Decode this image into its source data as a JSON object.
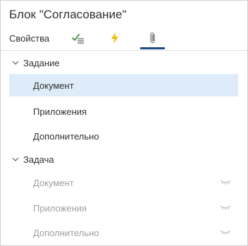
{
  "block": {
    "title": "Блок \"Согласование\""
  },
  "tabs": [
    {
      "label": "Свойства",
      "icon": ""
    },
    {
      "label": "",
      "icon": "checklist-icon"
    },
    {
      "label": "",
      "icon": "lightning-icon"
    },
    {
      "label": "",
      "icon": "paperclip-icon"
    }
  ],
  "colors": {
    "accent": "#1e4a86",
    "selected_bg": "#deecf9",
    "checklist_green": "#2e8b2e",
    "lightning_yellow": "#f2b705"
  },
  "groups": [
    {
      "label": "Задание",
      "items": [
        {
          "label": "Документ",
          "state": "selected"
        },
        {
          "label": "Приложения",
          "state": "enabled"
        },
        {
          "label": "Дополнительно",
          "state": "enabled"
        }
      ]
    },
    {
      "label": "Задача",
      "items": [
        {
          "label": "Документ",
          "state": "disabled",
          "icon": "eye-hidden-icon"
        },
        {
          "label": "Приложения",
          "state": "disabled",
          "icon": "eye-hidden-icon"
        },
        {
          "label": "Дополнительно",
          "state": "disabled",
          "icon": "eye-hidden-icon"
        }
      ]
    }
  ]
}
